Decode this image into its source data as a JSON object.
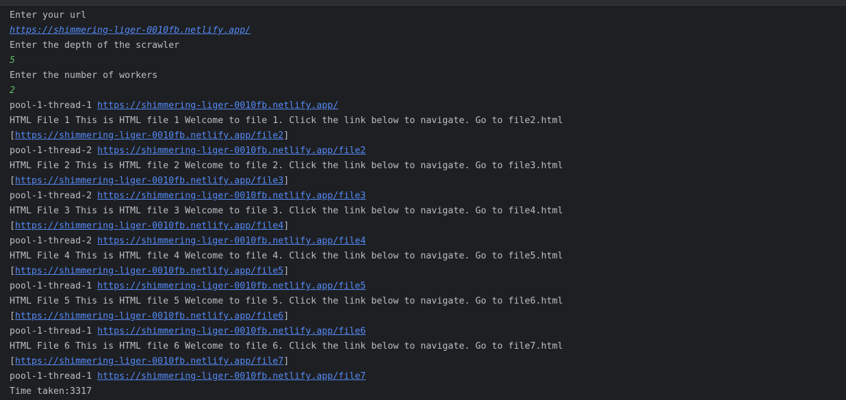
{
  "console": {
    "prompt_url": "Enter your url",
    "input_url": "https://shimmering-liger-0010fb.netlify.app/",
    "prompt_depth": "Enter the depth of the scrawler",
    "input_depth": "5",
    "prompt_workers": "Enter the number of workers",
    "input_workers": "2",
    "entries": [
      {
        "thread": "pool-1-thread-1",
        "url": "https://shimmering-liger-0010fb.netlify.app/",
        "content": "HTML File 1 This is HTML file 1 Welcome to file 1. Click the link below to navigate. Go to file2.html",
        "found_link": "https://shimmering-liger-0010fb.netlify.app/file2"
      },
      {
        "thread": "pool-1-thread-2",
        "url": "https://shimmering-liger-0010fb.netlify.app/file2",
        "content": "HTML File 2 This is HTML file 2 Welcome to file 2. Click the link below to navigate. Go to file3.html",
        "found_link": "https://shimmering-liger-0010fb.netlify.app/file3"
      },
      {
        "thread": "pool-1-thread-2",
        "url": "https://shimmering-liger-0010fb.netlify.app/file3",
        "content": "HTML File 3 This is HTML file 3 Welcome to file 3. Click the link below to navigate. Go to file4.html",
        "found_link": "https://shimmering-liger-0010fb.netlify.app/file4"
      },
      {
        "thread": "pool-1-thread-2",
        "url": "https://shimmering-liger-0010fb.netlify.app/file4",
        "content": "HTML File 4 This is HTML file 4 Welcome to file 4. Click the link below to navigate. Go to file5.html",
        "found_link": "https://shimmering-liger-0010fb.netlify.app/file5"
      },
      {
        "thread": "pool-1-thread-1",
        "url": "https://shimmering-liger-0010fb.netlify.app/file5",
        "content": "HTML File 5 This is HTML file 5 Welcome to file 5. Click the link below to navigate. Go to file6.html",
        "found_link": "https://shimmering-liger-0010fb.netlify.app/file6"
      },
      {
        "thread": "pool-1-thread-1",
        "url": "https://shimmering-liger-0010fb.netlify.app/file6",
        "content": "HTML File 6 This is HTML file 6 Welcome to file 6. Click the link below to navigate. Go to file7.html",
        "found_link": "https://shimmering-liger-0010fb.netlify.app/file7"
      }
    ],
    "last_thread": "pool-1-thread-1",
    "last_url": "https://shimmering-liger-0010fb.netlify.app/file7",
    "time_taken": "Time taken:3317",
    "bracket_open": "[",
    "bracket_close": "]",
    "space": " "
  },
  "colors": {
    "background": "#1e1f22",
    "text": "#bcbec4",
    "link": "#548af7",
    "user_input": "#5fb865"
  }
}
